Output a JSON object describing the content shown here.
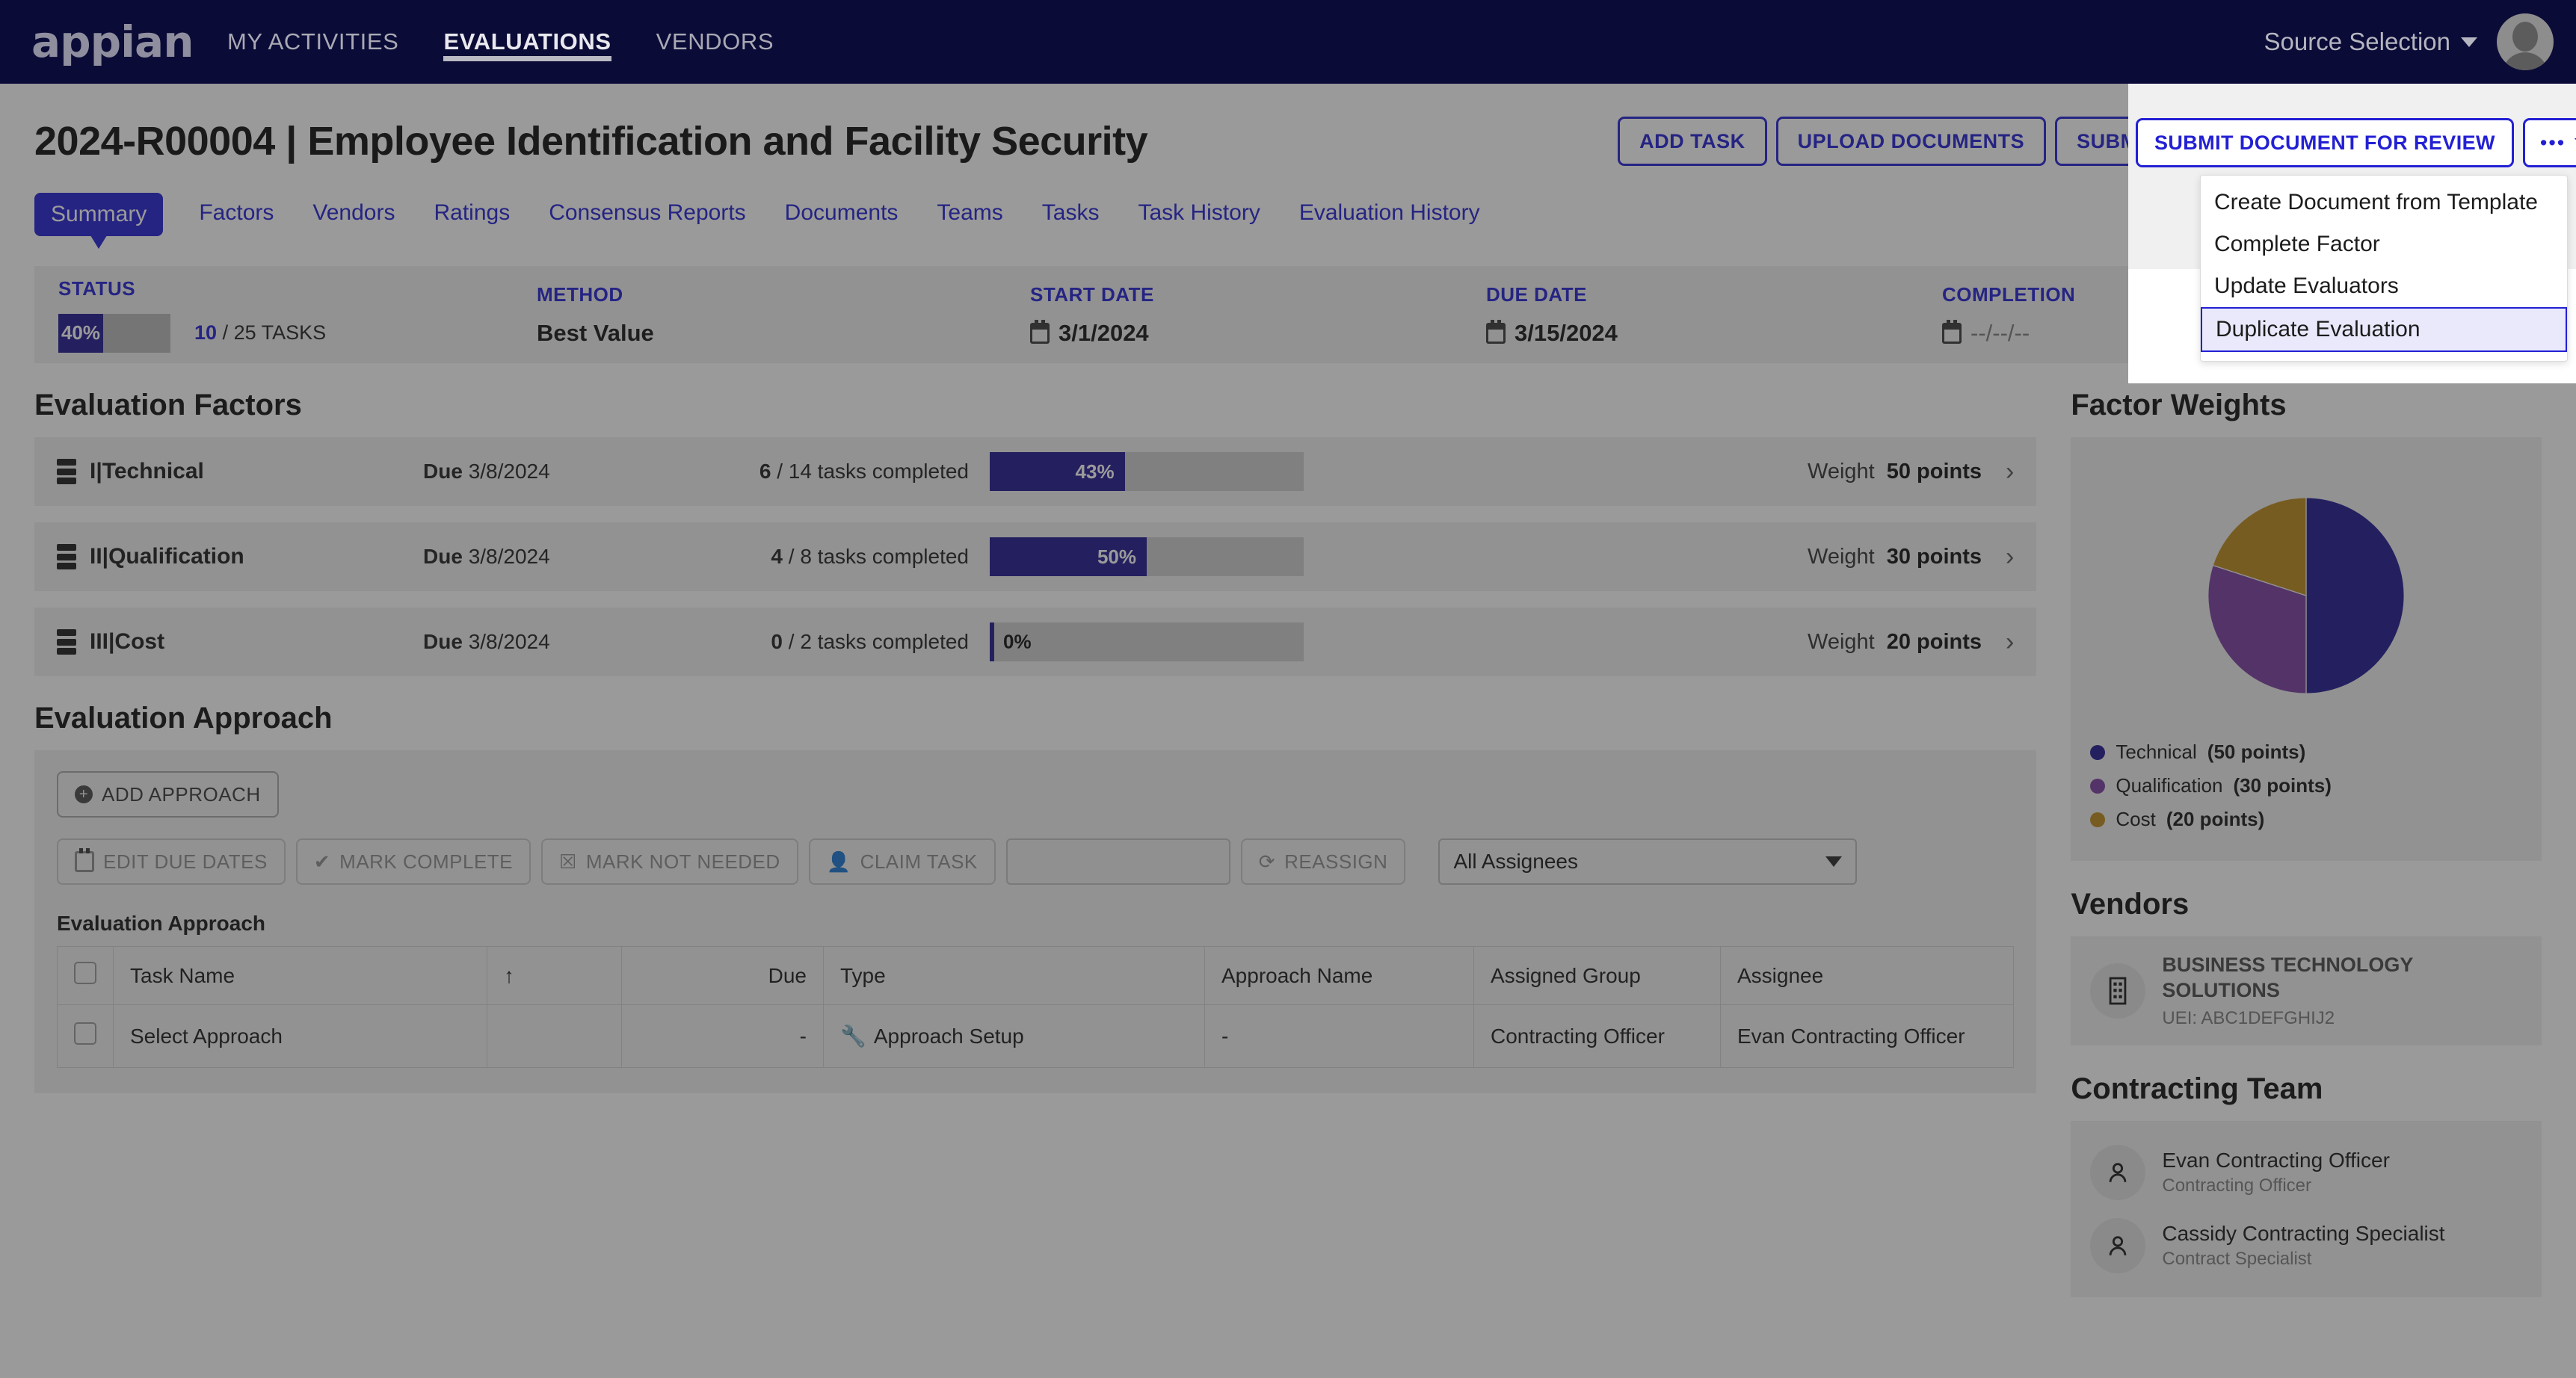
{
  "topnav": {
    "brand": "appian",
    "links": [
      {
        "label": "MY ACTIVITIES",
        "active": false
      },
      {
        "label": "EVALUATIONS",
        "active": true
      },
      {
        "label": "VENDORS",
        "active": false
      }
    ],
    "source_selection": "Source Selection",
    "avatar": "user-avatar"
  },
  "header": {
    "title": "2024-R00004 | Employee Identification and Facility Security",
    "buttons": {
      "add_task": "ADD TASK",
      "upload_documents": "UPLOAD DOCUMENTS",
      "submit_document": "SUBMIT DOCUMENT FOR REVIEW",
      "kebab_dots": "•••"
    }
  },
  "tabs": [
    {
      "label": "Summary",
      "active": true
    },
    {
      "label": "Factors",
      "active": false
    },
    {
      "label": "Vendors",
      "active": false
    },
    {
      "label": "Ratings",
      "active": false
    },
    {
      "label": "Consensus Reports",
      "active": false
    },
    {
      "label": "Documents",
      "active": false
    },
    {
      "label": "Teams",
      "active": false
    },
    {
      "label": "Tasks",
      "active": false
    },
    {
      "label": "Task History",
      "active": false
    },
    {
      "label": "Evaluation History",
      "active": false
    }
  ],
  "status_strip": {
    "status_label": "STATUS",
    "status_percent": "40%",
    "status_percent_value": 40,
    "tasks_done": "10",
    "tasks_total": "/ 25 TASKS",
    "method_label": "METHOD",
    "method_value": "Best Value",
    "start_label": "START DATE",
    "start_value": "3/1/2024",
    "due_label": "DUE DATE",
    "due_value": "3/15/2024",
    "completion_label": "COMPLETION",
    "completion_value": "--/--/--"
  },
  "evaluation_factors": {
    "title": "Evaluation Factors",
    "due_word": "Due",
    "weight_word": "Weight",
    "rows": [
      {
        "name": "I|Technical",
        "due": "3/8/2024",
        "done": "6",
        "tasks": "/ 14 tasks completed",
        "pct": 43,
        "pct_label": "43%",
        "weight": "50 points"
      },
      {
        "name": "II|Qualification",
        "due": "3/8/2024",
        "done": "4",
        "tasks": "/ 8 tasks completed",
        "pct": 50,
        "pct_label": "50%",
        "weight": "30 points"
      },
      {
        "name": "III|Cost",
        "due": "3/8/2024",
        "done": "0",
        "tasks": "/ 2 tasks completed",
        "pct": 0,
        "pct_label": "0%",
        "weight": "20 points"
      }
    ]
  },
  "evaluation_approach": {
    "title": "Evaluation Approach",
    "add_approach": "ADD APPROACH",
    "toolbar": {
      "edit_due_dates": "EDIT DUE DATES",
      "mark_complete": "MARK COMPLETE",
      "mark_not_needed": "MARK NOT NEEDED",
      "claim_task": "CLAIM TASK",
      "reassign": "REASSIGN",
      "search_placeholder": "",
      "assignee_filter": "All Assignees"
    },
    "table_title": "Evaluation Approach",
    "columns": [
      "",
      "Task Name",
      "",
      "Due",
      "Type",
      "Approach Name",
      "Assigned Group",
      "Assignee"
    ],
    "sort_indicator": "↑",
    "rows": [
      {
        "task_name": "Select Approach",
        "due": "-",
        "type": "Approach Setup",
        "type_icon": "wrench-icon",
        "approach_name": "-",
        "assigned_group": "Contracting Officer",
        "assignee": "Evan Contracting Officer"
      }
    ]
  },
  "sidebar": {
    "factor_weights_title": "Factor Weights",
    "vendors_title": "Vendors",
    "vendors": [
      {
        "name": "BUSINESS TECHNOLOGY SOLUTIONS",
        "uei": "UEI: ABC1DEFGHIJ2",
        "icon": "building-icon"
      }
    ],
    "contracting_team_title": "Contracting Team",
    "team": [
      {
        "name": "Evan Contracting Officer",
        "role": "Contracting Officer",
        "icon": "person-icon"
      },
      {
        "name": "Cassidy Contracting Specialist",
        "role": "Contract Specialist",
        "icon": "person-icon"
      }
    ]
  },
  "dropdown_menu": {
    "items": [
      {
        "label": "Create Document from Template",
        "selected": false
      },
      {
        "label": "Complete Factor",
        "selected": false
      },
      {
        "label": "Update Evaluators",
        "selected": false
      },
      {
        "label": "Duplicate Evaluation",
        "selected": true
      }
    ]
  },
  "colors": {
    "nav_bg": "#0b0b37",
    "accent": "#2320d4",
    "progress": "#201a91",
    "technical": "#201a91",
    "qualification": "#7b3fa0",
    "cost": "#bd8b1e",
    "panel": "#f0f0f0"
  },
  "chart_data": {
    "type": "pie",
    "title": "Factor Weights",
    "labels": [
      "Technical",
      "Qualification",
      "Cost"
    ],
    "values": [
      50,
      30,
      20
    ],
    "unit": "points",
    "colors": [
      "#201a91",
      "#7b3fa0",
      "#bd8b1e"
    ],
    "legend": [
      {
        "name": "Technical",
        "value": "(50 points)",
        "color": "#201a91"
      },
      {
        "name": "Qualification",
        "value": "(30 points)",
        "color": "#7b3fa0"
      },
      {
        "name": "Cost",
        "value": "(20 points)",
        "color": "#bd8b1e"
      }
    ],
    "legend_position": "bottom"
  }
}
